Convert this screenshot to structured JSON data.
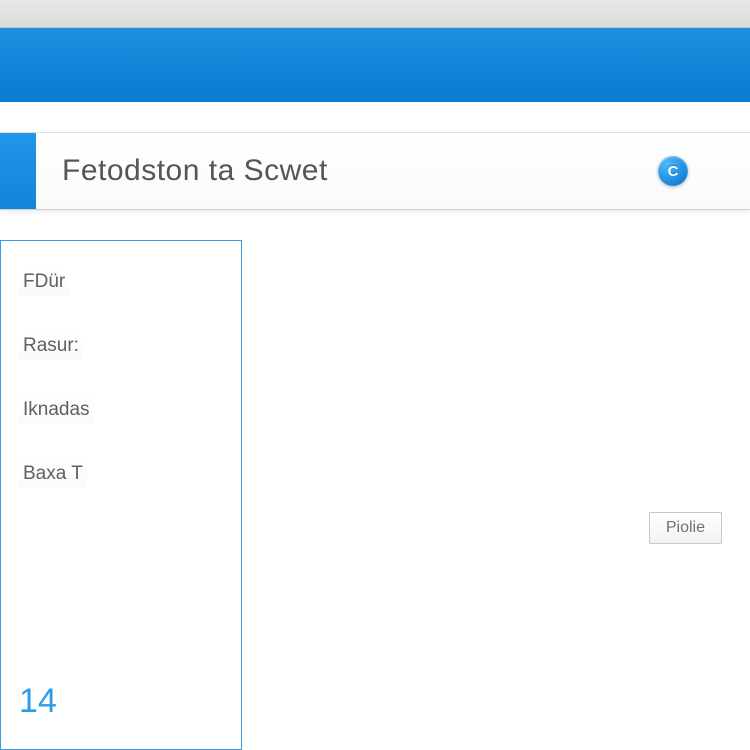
{
  "header": {
    "title": "Fetodston ta Scwet"
  },
  "action_icon": {
    "glyph": "C"
  },
  "sidebar": {
    "items": [
      {
        "label": "FDür"
      },
      {
        "label": "Rasur:"
      },
      {
        "label": "Iknadas"
      },
      {
        "label": "Baxa T"
      }
    ],
    "number": "14"
  },
  "buttons": {
    "right_label": "Piolie"
  }
}
